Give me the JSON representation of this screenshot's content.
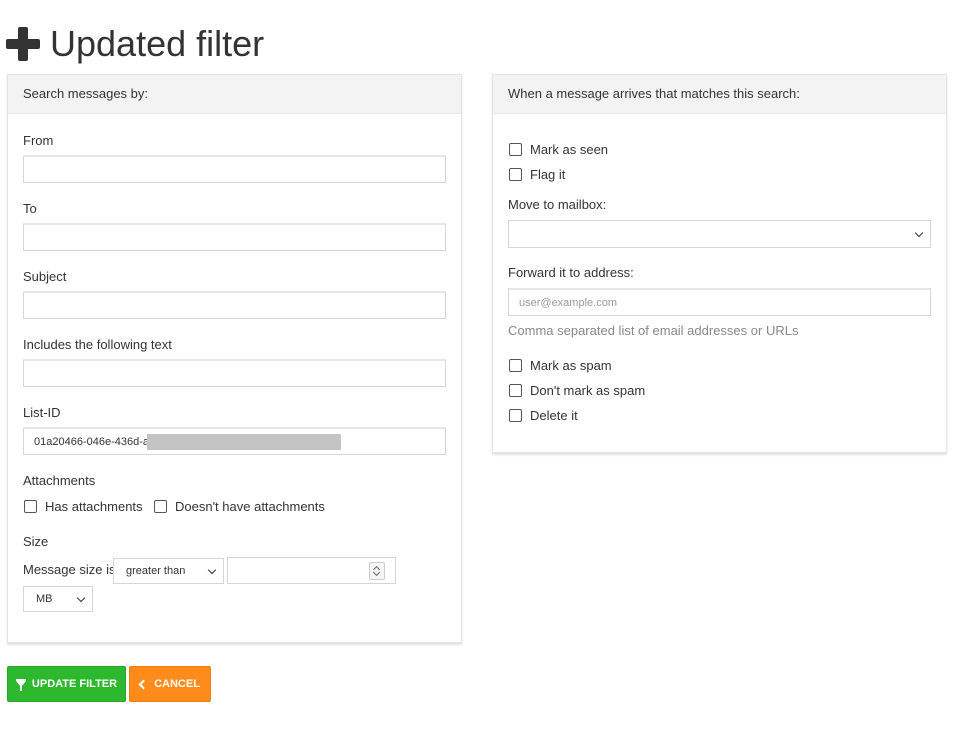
{
  "page": {
    "title": "Updated filter"
  },
  "search": {
    "header": "Search messages by:",
    "from_label": "From",
    "from_value": "",
    "to_label": "To",
    "to_value": "",
    "subject_label": "Subject",
    "subject_value": "",
    "includes_label": "Includes the following text",
    "includes_value": "",
    "listid_label": "List-ID",
    "listid_value": "01a20466-046e-436d-a",
    "attachments_label": "Attachments",
    "has_attachments": "Has attachments",
    "no_attachments": "Doesn't have attachments",
    "size_label": "Size",
    "message_size_is": "Message size is",
    "comparison_selected": "greater than",
    "size_value": "",
    "unit_selected": "MB"
  },
  "actions": {
    "header": "When a message arrives that matches this search:",
    "mark_seen": "Mark as seen",
    "flag_it": "Flag it",
    "move_label": "Move to mailbox:",
    "move_selected": "",
    "forward_label": "Forward it to address:",
    "forward_placeholder": "user@example.com",
    "forward_hint": "Comma separated list of email addresses or URLs",
    "mark_spam": "Mark as spam",
    "dont_mark_spam": "Don't mark as spam",
    "delete_it": "Delete it"
  },
  "buttons": {
    "update": "UPDATE FILTER",
    "cancel": "CANCEL"
  },
  "colors": {
    "update": "#2eb82e",
    "cancel": "#ff8c1a"
  }
}
